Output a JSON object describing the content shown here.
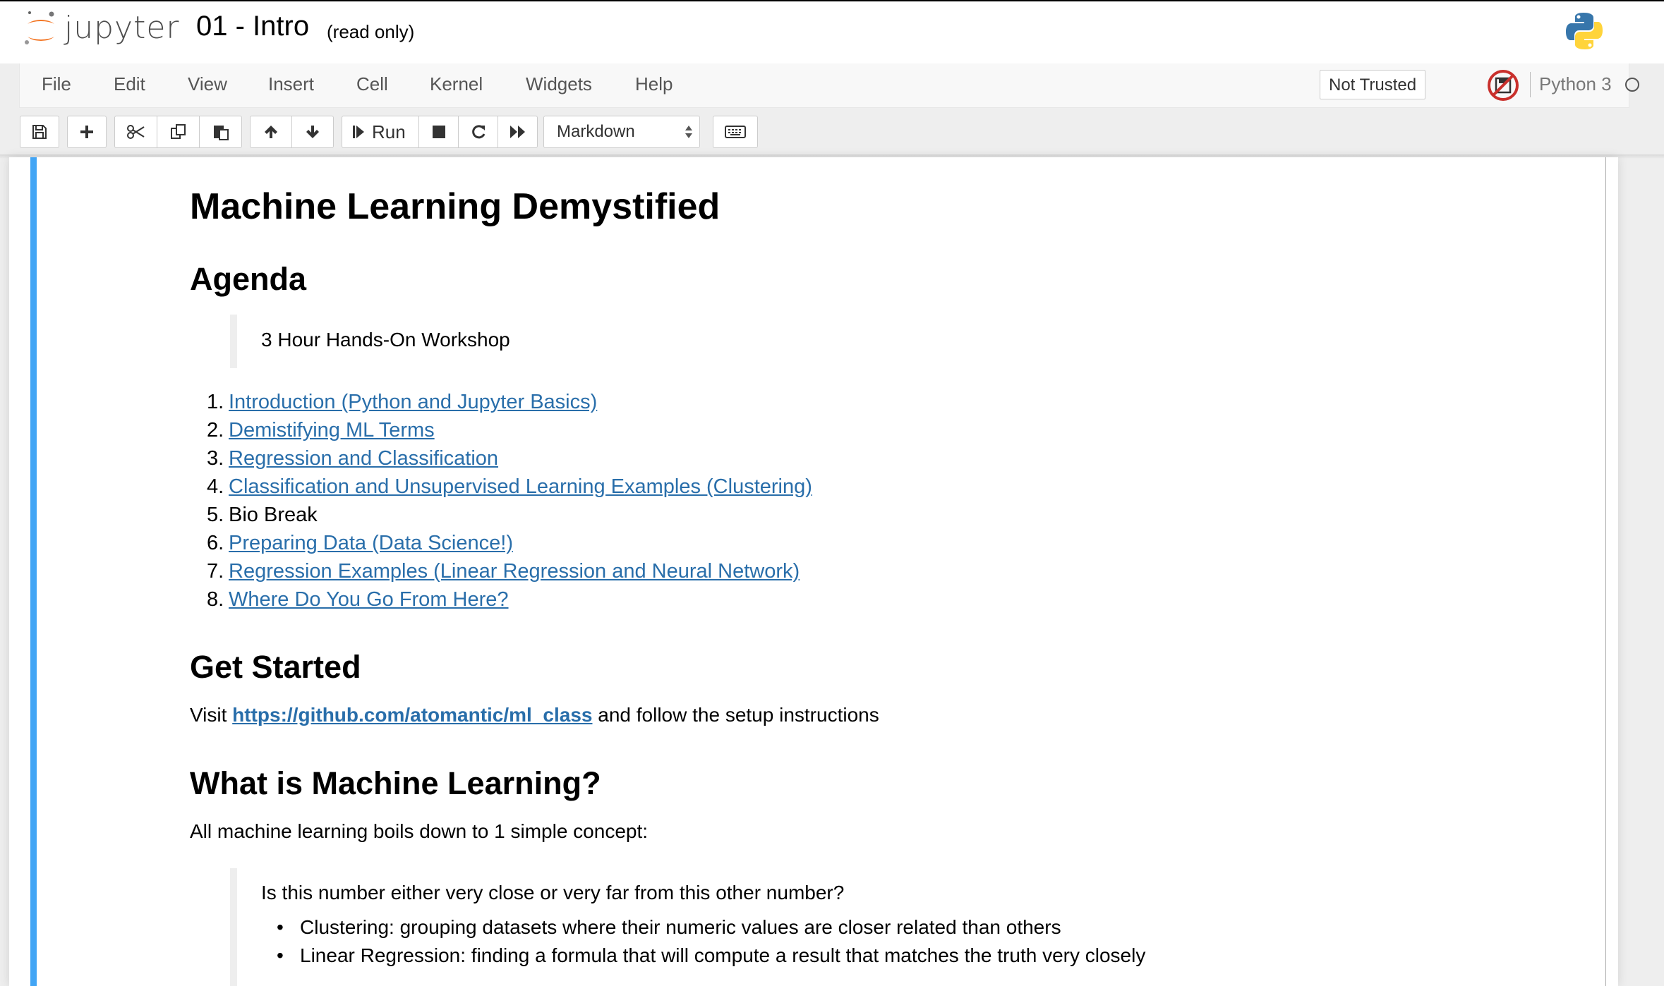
{
  "header": {
    "logo_text": "jupyter",
    "notebook_title": "01 - Intro",
    "read_only": "(read only)"
  },
  "menubar": {
    "items": [
      "File",
      "Edit",
      "View",
      "Insert",
      "Cell",
      "Kernel",
      "Widgets",
      "Help"
    ],
    "not_trusted": "Not Trusted",
    "kernel_name": "Python 3"
  },
  "toolbar": {
    "run_label": "Run",
    "cell_type": "Markdown"
  },
  "notebook": {
    "title": "Machine Learning Demystified",
    "agenda_heading": "Agenda",
    "agenda_quote": "3 Hour Hands-On Workshop",
    "agenda_items": [
      {
        "num": "1.",
        "text": "Introduction (Python and Jupyter Basics)",
        "link": true
      },
      {
        "num": "2.",
        "text": "Demistifying ML Terms",
        "link": true
      },
      {
        "num": "3.",
        "text": "Regression and Classification",
        "link": true
      },
      {
        "num": "4.",
        "text": "Classification and Unsupervised Learning Examples (Clustering)",
        "link": true
      },
      {
        "num": "5.",
        "text": "Bio Break",
        "link": false
      },
      {
        "num": "6.",
        "text": "Preparing Data (Data Science!)",
        "link": true
      },
      {
        "num": "7.",
        "text": "Regression Examples (Linear Regression and Neural Network)",
        "link": true
      },
      {
        "num": "8.",
        "text": "Where Do You Go From Here?",
        "link": true
      }
    ],
    "get_started_heading": "Get Started",
    "get_started_prefix": "Visit",
    "get_started_link": "https://github.com/atomantic/ml_class",
    "get_started_suffix": "and follow the setup instructions",
    "what_is_heading": "What is Machine Learning?",
    "what_is_para": "All machine learning boils down to 1 simple concept:",
    "concept_quote": "Is this number either very close or very far from this other number?",
    "concept_bullets": [
      "Clustering: grouping datasets where their numeric values are closer related than others",
      "Linear Regression: finding a formula that will compute a result that matches the truth very closely"
    ]
  },
  "colors": {
    "accent_cell": "#42a5f5",
    "link": "#296eaa",
    "logo_orange": "#f37726"
  }
}
